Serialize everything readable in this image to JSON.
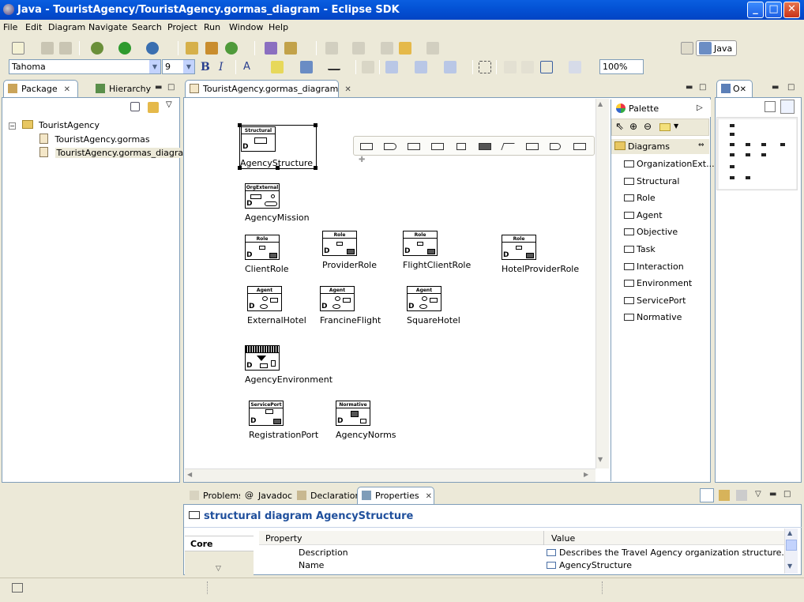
{
  "window": {
    "title": "Java - TouristAgency/TouristAgency.gormas_diagram - Eclipse SDK"
  },
  "menu": [
    "File",
    "Edit",
    "Diagram",
    "Navigate",
    "Search",
    "Project",
    "Run",
    "Window",
    "Help"
  ],
  "font_toolbar": {
    "font": "Tahoma",
    "size": "9",
    "zoom": "100%",
    "bold": "B",
    "italic": "I",
    "text_color": "A"
  },
  "perspective": {
    "label": "Java"
  },
  "package_explorer": {
    "tabs": [
      "Package",
      "Hierarchy"
    ],
    "tree": [
      {
        "label": "TouristAgency",
        "level": 0
      },
      {
        "label": "TouristAgency.gormas",
        "level": 1
      },
      {
        "label": "TouristAgency.gormas_diagram",
        "level": 1
      }
    ]
  },
  "editor": {
    "tab": "TouristAgency.gormas_diagram",
    "nodes": [
      {
        "name": "AgencyStructure",
        "type": "Structural"
      },
      {
        "name": "AgencyMission",
        "type": "OrgExternal"
      },
      {
        "name": "ClientRole",
        "type": "Role"
      },
      {
        "name": "ProviderRole",
        "type": "Role"
      },
      {
        "name": "FlightClientRole",
        "type": "Role"
      },
      {
        "name": "HotelProviderRole",
        "type": "Role"
      },
      {
        "name": "ExternalHotel",
        "type": "Agent"
      },
      {
        "name": "FrancineFlight",
        "type": "Agent"
      },
      {
        "name": "SquareHotel",
        "type": "Agent"
      },
      {
        "name": "AgencyEnvironment",
        "type": ""
      },
      {
        "name": "RegistrationPort",
        "type": "ServicePort"
      },
      {
        "name": "AgencyNorms",
        "type": "Normative"
      }
    ],
    "d_letter": "D"
  },
  "palette": {
    "title": "Palette",
    "drawer": "Diagrams",
    "items": [
      "OrganizationExt...",
      "Structural",
      "Role",
      "Agent",
      "Objective",
      "Task",
      "Interaction",
      "Environment",
      "ServicePort",
      "Normative"
    ]
  },
  "outline": {
    "tab": "O"
  },
  "bottom": {
    "tabs": [
      "Problems",
      "Javadoc",
      "Declaration",
      "Properties"
    ],
    "header": "structural diagram AgencyStructure",
    "section": "Core",
    "columns": [
      "Property",
      "Value"
    ],
    "rows": [
      {
        "property": "Description",
        "value": "Describes the Travel Agency organization structure."
      },
      {
        "property": "Name",
        "value": "AgencyStructure"
      }
    ]
  },
  "colors": {
    "titlebar": "#0453d6",
    "selection": "#316ac5",
    "header_text": "#1f4f9c"
  }
}
